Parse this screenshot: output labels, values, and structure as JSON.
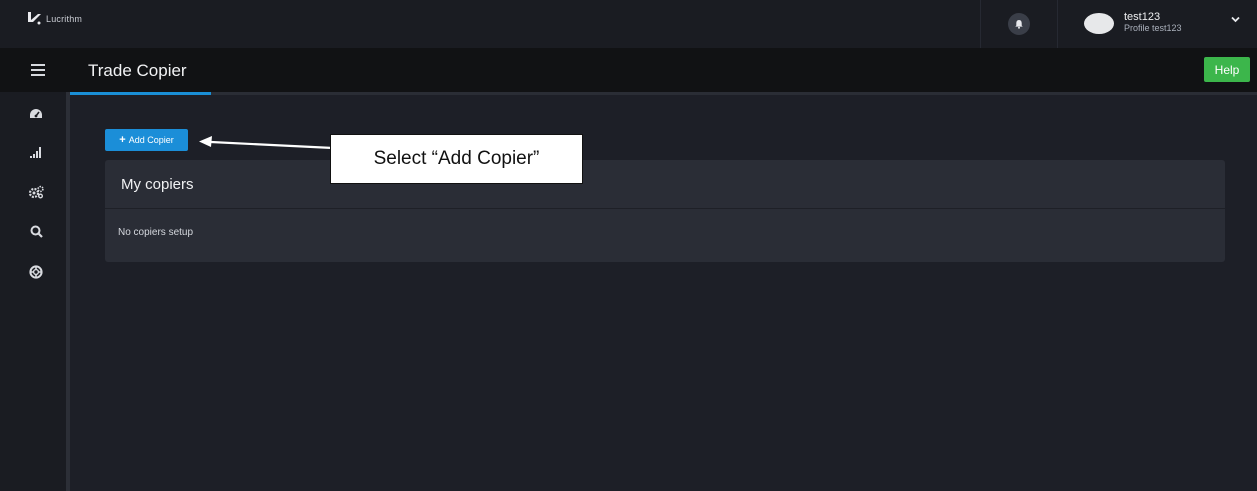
{
  "brand": {
    "name": "Lucrithm"
  },
  "user": {
    "name": "test123",
    "profile": "Profile test123"
  },
  "header": {
    "title": "Trade Copier",
    "help_label": "Help"
  },
  "sidebar": {
    "icons": [
      "dashboard-icon",
      "signal-bars-icon",
      "gears-icon",
      "search-icon",
      "lifebuoy-icon"
    ]
  },
  "main": {
    "add_button": {
      "icon": "plus-icon",
      "label": "Add Copier"
    },
    "panel": {
      "title": "My copiers",
      "empty_text": "No copiers setup"
    }
  },
  "annotation": {
    "text": "Select “Add Copier”"
  },
  "colors": {
    "accent_blue": "#1b8ed8",
    "help_green": "#3cb64b"
  }
}
